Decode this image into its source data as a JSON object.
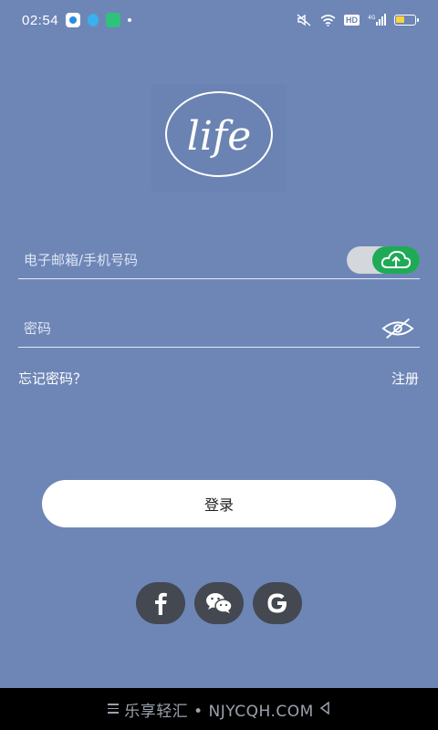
{
  "status_bar": {
    "time": "02:54",
    "hd": "HD",
    "network": "4G",
    "icons": [
      "app-notification-icon",
      "app-notification-icon",
      "app-notification-icon",
      "mute-icon",
      "wifi-icon",
      "signal-icon",
      "battery-icon"
    ]
  },
  "logo": {
    "text": "life"
  },
  "email_field": {
    "placeholder": "电子邮箱/手机号码",
    "value": "",
    "toggle_icon": "cloud-upload-icon",
    "toggle_color": "#1faa57"
  },
  "password_field": {
    "placeholder": "密码",
    "value": "",
    "icon": "eye-off-icon"
  },
  "links": {
    "forgot_password": "忘记密码？",
    "register": "注册"
  },
  "login_button": {
    "label": "登录"
  },
  "social_login": [
    {
      "name": "facebook",
      "icon": "facebook-icon"
    },
    {
      "name": "wechat",
      "icon": "wechat-icon"
    },
    {
      "name": "google",
      "icon": "google-icon"
    }
  ],
  "nav_bar": {
    "watermark": "乐享轻汇 • NJYCQH.COM"
  },
  "colors": {
    "background": "#6d86b6",
    "button": "#ffffff",
    "social_button": "#444851",
    "toggle_active": "#1faa57"
  }
}
